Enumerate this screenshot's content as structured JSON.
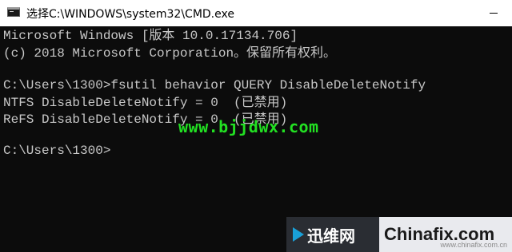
{
  "window": {
    "title": "选择C:\\WINDOWS\\system32\\CMD.exe",
    "minimize_icon": "minimize-icon"
  },
  "console": {
    "lines": [
      "Microsoft Windows [版本 10.0.17134.706]",
      "(c) 2018 Microsoft Corporation。保留所有权利。",
      "",
      "C:\\Users\\1300>fsutil behavior QUERY DisableDeleteNotify",
      "NTFS DisableDeleteNotify = 0  (已禁用)",
      "ReFS DisableDeleteNotify = 0  (已禁用)",
      "",
      "C:\\Users\\1300>"
    ]
  },
  "watermarks": {
    "site": "www.bjjdwx.com",
    "xunwei": "迅维网",
    "chinafix": "Chinafix.com",
    "chinafix_sub": "www.chinafix.com.cn"
  },
  "colors": {
    "console_bg": "#0c0c0c",
    "console_text": "#c8c8c8",
    "watermark_green": "#22e022"
  }
}
